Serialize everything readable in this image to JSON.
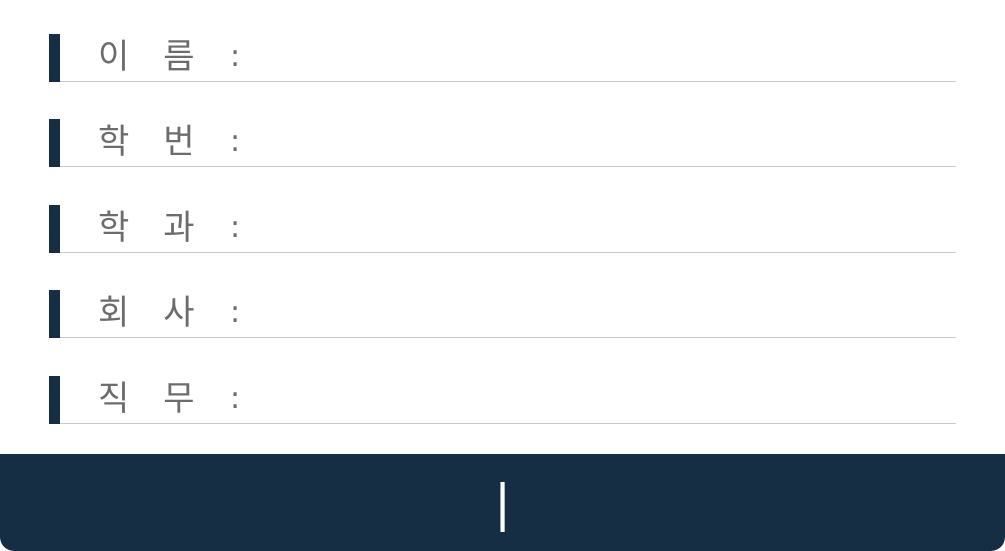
{
  "colors": {
    "accent": "#162e43",
    "label": "#6c6c6c",
    "divider": "#c8c8c8",
    "footer_text": "#ffffff"
  },
  "form": {
    "fields": [
      {
        "label": "이름",
        "separator": ":",
        "value": ""
      },
      {
        "label": "학번",
        "separator": ":",
        "value": ""
      },
      {
        "label": "학과",
        "separator": ":",
        "value": ""
      },
      {
        "label": "회사",
        "separator": ":",
        "value": ""
      },
      {
        "label": "직무",
        "separator": ":",
        "value": ""
      }
    ]
  },
  "footer": {
    "text": "|"
  }
}
